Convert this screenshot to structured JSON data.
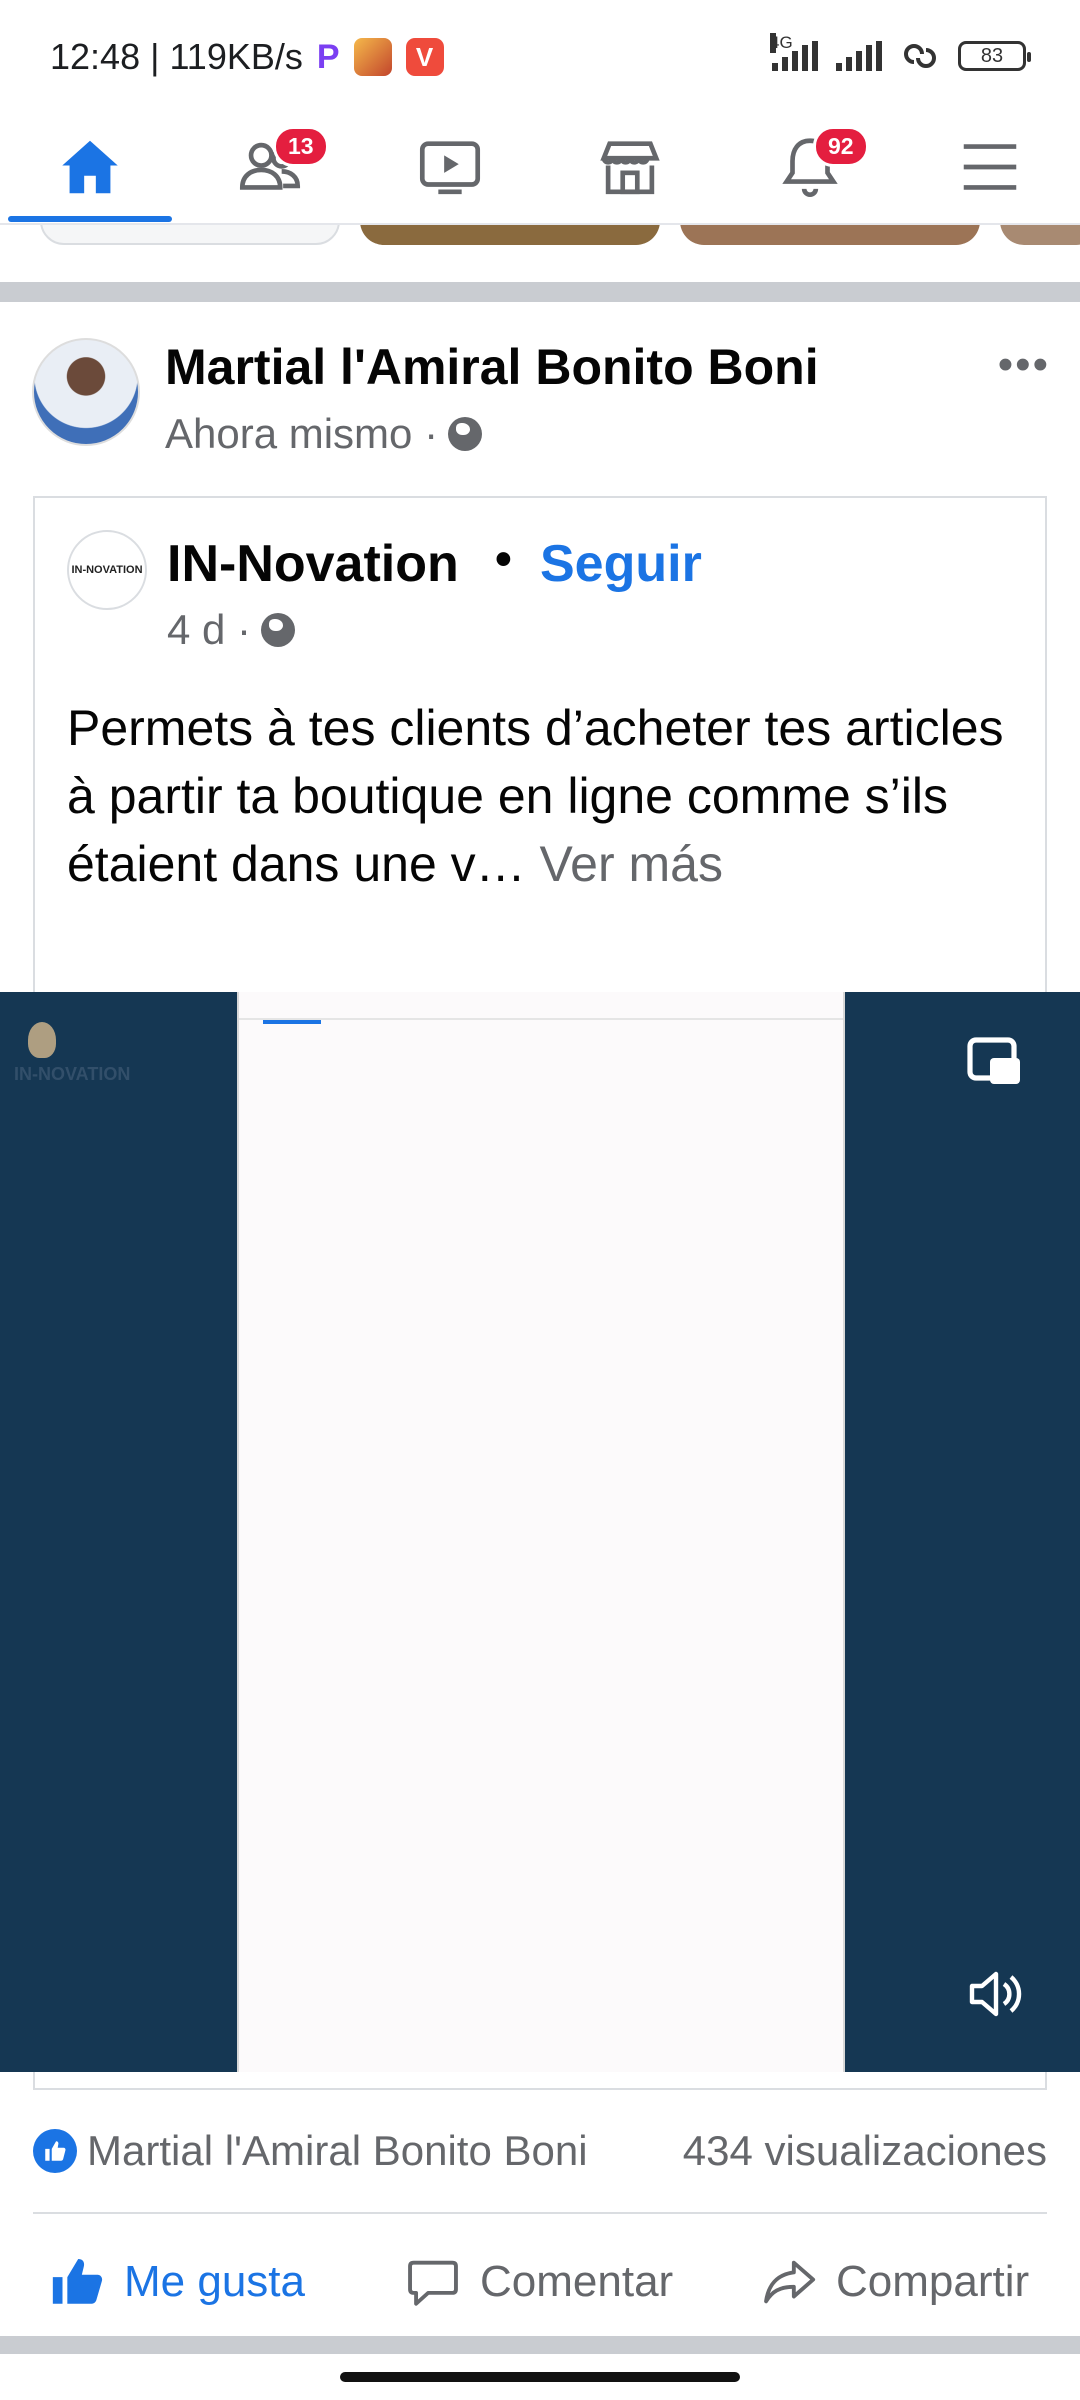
{
  "status_bar": {
    "time_speed": "12:48 | 119KB/s",
    "notif_p": "P",
    "notif_v": "V",
    "network": "4G",
    "battery": "83"
  },
  "nav": {
    "items": [
      {
        "name": "home",
        "icon": "home-icon",
        "active": true
      },
      {
        "name": "friends",
        "icon": "friends-icon",
        "badge": "13"
      },
      {
        "name": "watch",
        "icon": "video-icon"
      },
      {
        "name": "marketplace",
        "icon": "store-icon"
      },
      {
        "name": "notifications",
        "icon": "bell-icon",
        "badge": "92"
      },
      {
        "name": "menu",
        "icon": "menu-icon"
      }
    ],
    "accent": "#1b74e4",
    "badge_color": "#e41e3f"
  },
  "post": {
    "author": "Martial l'Amiral Bonito Boni",
    "time": "Ahora mismo ·",
    "more": "•••",
    "shared": {
      "page_name": "IN-Novation",
      "page_logo_text": "IN-NOVATION",
      "separator": "•",
      "follow_label": "Seguir",
      "time": "4 d ·",
      "text": "Permets à tes clients d’acheter tes articles à partir ta boutique en ligne comme s’ils étaient dans une v…",
      "see_more": " Ver más"
    },
    "video": {
      "watermark": "IN-NOVATION",
      "background": "#153753"
    },
    "reactions": {
      "liker": "Martial l'Amiral Bonito Boni",
      "views": "434 visualizaciones"
    },
    "actions": {
      "like": "Me gusta",
      "comment": "Comentar",
      "share": "Compartir"
    }
  }
}
